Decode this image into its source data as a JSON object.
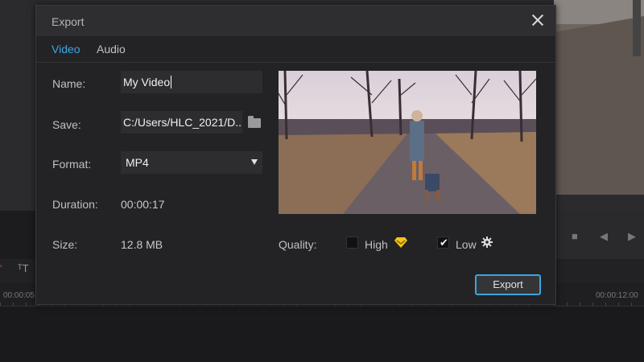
{
  "dialog": {
    "title": "Export",
    "tabs": [
      {
        "label": "Video",
        "active": true
      },
      {
        "label": "Audio",
        "active": false
      }
    ],
    "fields": {
      "name_label": "Name:",
      "name_value": "My Video",
      "save_label": "Save:",
      "save_value": "C:/Users/HLC_2021/D...",
      "format_label": "Format:",
      "format_value": "MP4",
      "duration_label": "Duration:",
      "duration_value": "00:00:17",
      "size_label": "Size:",
      "size_value": "12.8 MB"
    },
    "quality": {
      "label": "Quality:",
      "options": [
        {
          "label": "High",
          "checked": false,
          "icon": "premium-diamond-icon"
        },
        {
          "label": "Low",
          "checked": true,
          "icon": "gear-icon"
        }
      ]
    },
    "export_button": "Export",
    "accent_color": "#3fa7e0",
    "premium_color": "#f5c518"
  },
  "timeline": {
    "timestamps": [
      "00:00:05",
      "00:00:12:00"
    ]
  }
}
